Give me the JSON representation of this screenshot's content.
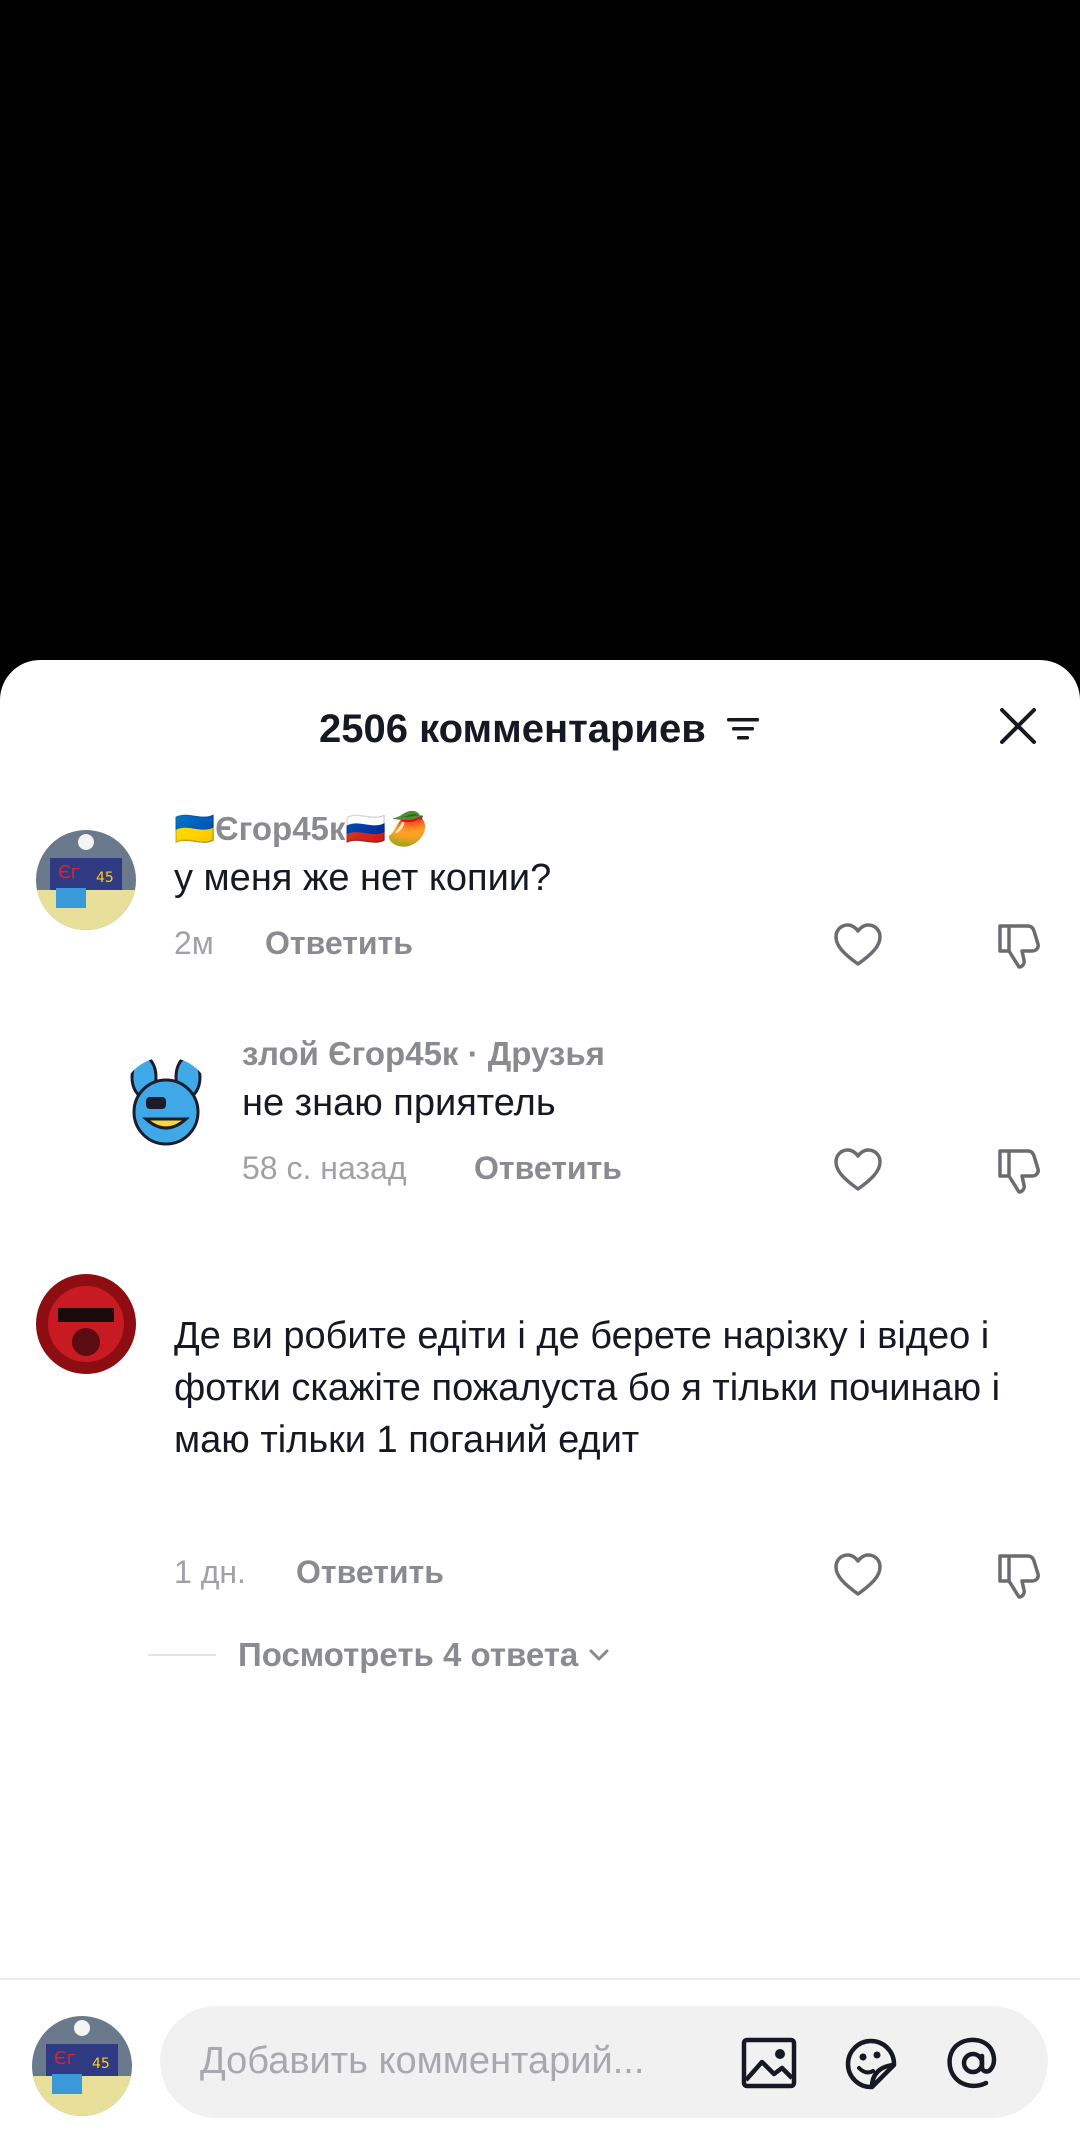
{
  "header": {
    "title": "2506 комментариев"
  },
  "comments": [
    {
      "username": "🇺🇦Єгор45к🇷🇺🥭",
      "text": "у меня же нет копии?",
      "time": "2м",
      "reply_label": "Ответить"
    },
    {
      "username": "злой Єгор45к · Друзья",
      "text": "не знаю приятель",
      "time": "58 с. назад",
      "reply_label": "Ответить"
    },
    {
      "username": "",
      "text": "Де ви робите едіти і де берете нарізку і відео і фотки скажіте пожалуста бо я тільки починаю і маю тільки 1 поганий едит",
      "time": "1 дн.",
      "reply_label": "Ответить"
    }
  ],
  "view_replies": "Посмотреть 4 ответа",
  "input": {
    "placeholder": "Добавить комментарий..."
  },
  "colors": {
    "text": "#161823",
    "muted": "#8a8b91",
    "pill": "#f1f1f2"
  }
}
